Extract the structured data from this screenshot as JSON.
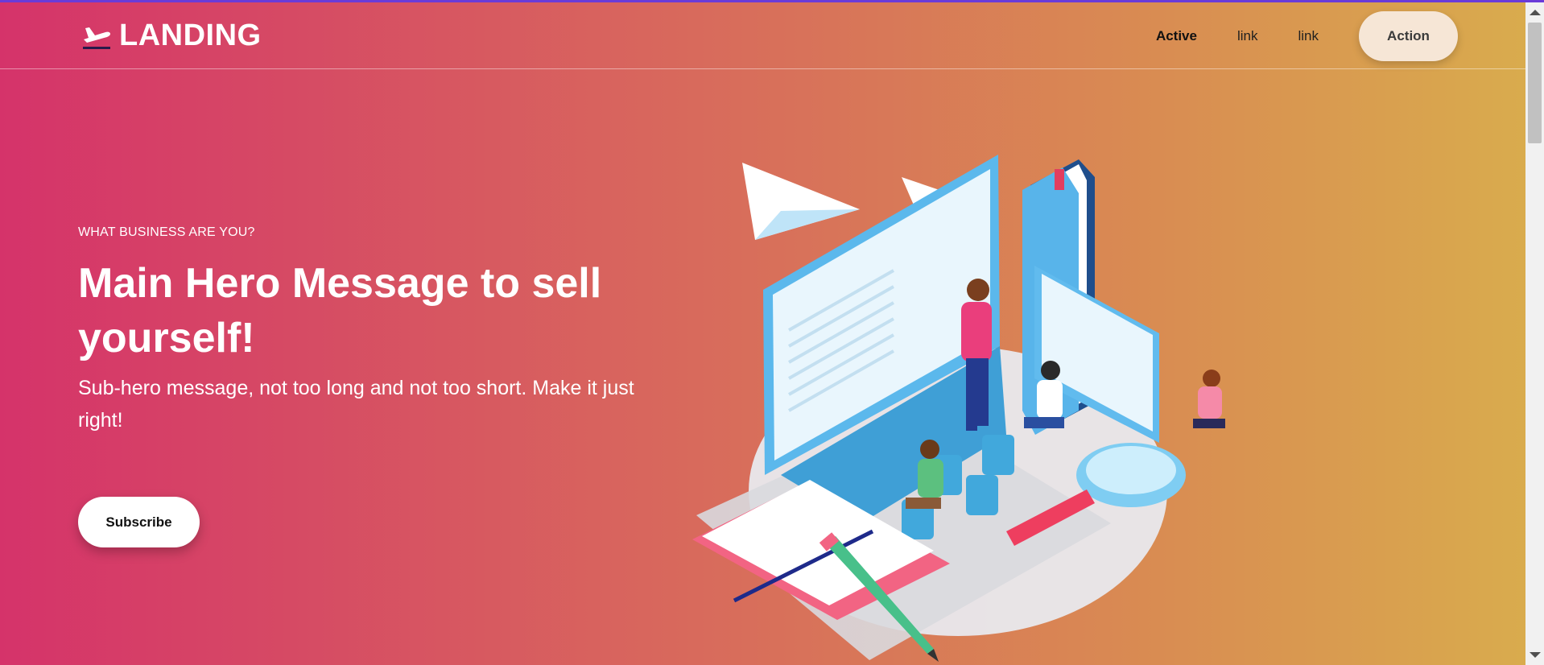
{
  "brand": {
    "name": "LANDING",
    "icon": "airplane-takeoff-icon"
  },
  "nav": {
    "links": [
      {
        "label": "Active",
        "active": true
      },
      {
        "label": "link",
        "active": false
      },
      {
        "label": "link",
        "active": false
      }
    ],
    "action_label": "Action"
  },
  "hero": {
    "eyebrow": "WHAT BUSINESS ARE YOU?",
    "headline": "Main Hero Message to sell yourself!",
    "subheadline": "Sub-hero message, not too long and not too short. Make it just right!",
    "cta_label": "Subscribe"
  },
  "colors": {
    "gradient_start": "#d5336a",
    "gradient_end": "#d9ad4d",
    "action_button_bg": "#f6e6d6",
    "cta_bg": "#ffffff"
  }
}
